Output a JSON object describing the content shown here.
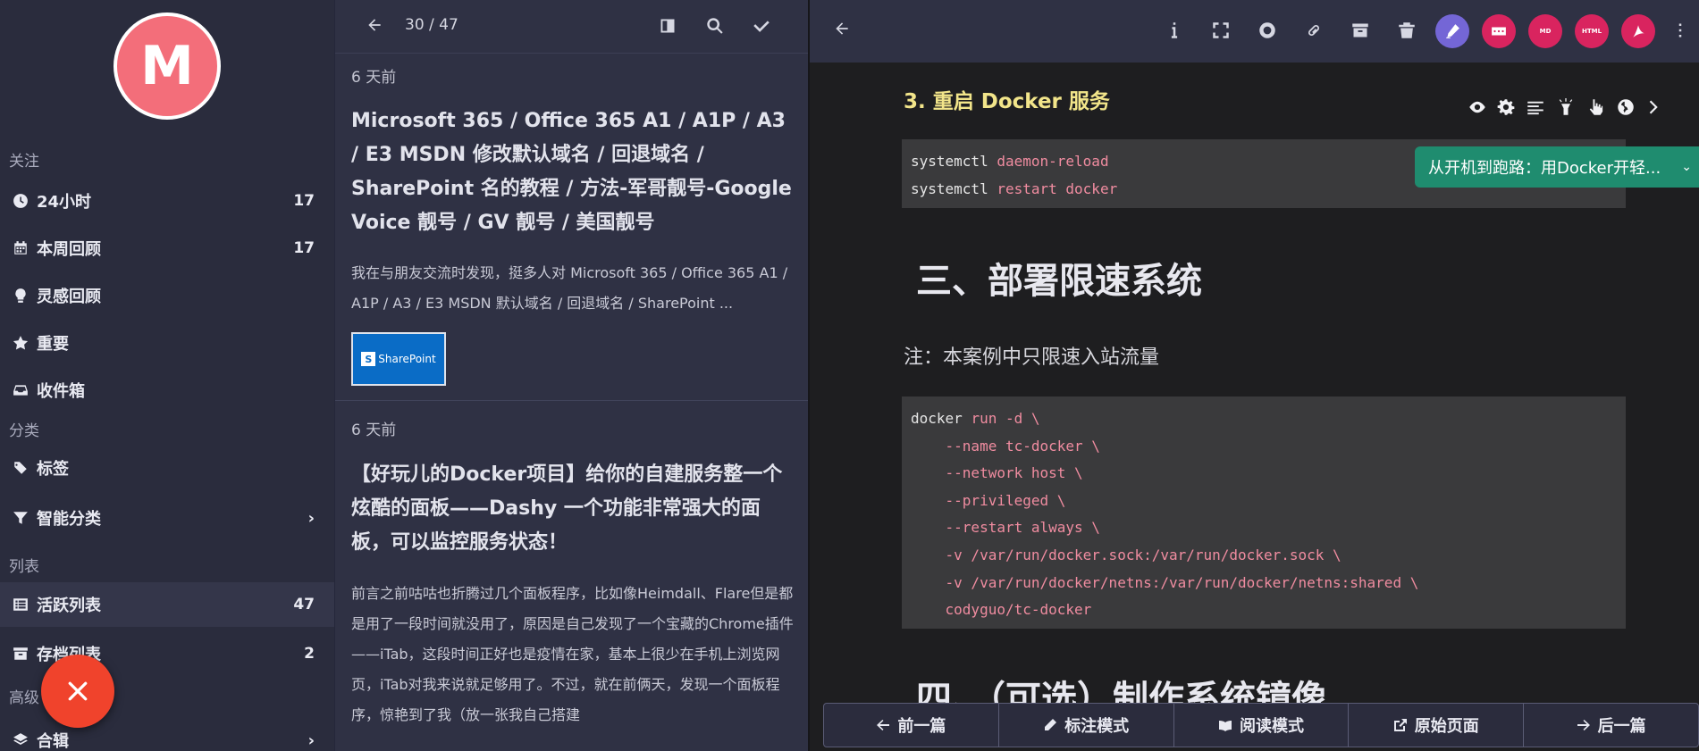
{
  "sidebar": {
    "avatar_letter": "M",
    "sections": {
      "follow": "关注",
      "category": "分类",
      "lists": "列表",
      "advanced": "高级"
    },
    "items": [
      {
        "label": "24小时",
        "count": "17",
        "icon": "clock-icon"
      },
      {
        "label": "本周回顾",
        "count": "17",
        "icon": "calendar-icon"
      },
      {
        "label": "灵感回顾",
        "count": "",
        "icon": "lightbulb-icon"
      },
      {
        "label": "重要",
        "count": "",
        "icon": "star-icon"
      },
      {
        "label": "收件箱",
        "count": "",
        "icon": "inbox-icon"
      },
      {
        "label": "标签",
        "count": "",
        "icon": "tags-icon"
      },
      {
        "label": "智能分类",
        "count": "",
        "icon": "filter-icon"
      },
      {
        "label": "活跃列表",
        "count": "47",
        "icon": "list-icon"
      },
      {
        "label": "存档列表",
        "count": "2",
        "icon": "archive-icon"
      },
      {
        "label": "合辑",
        "count": "",
        "icon": "layers-icon"
      }
    ],
    "fab_icon": "close-icon"
  },
  "list": {
    "counter": "30 / 47",
    "articles": [
      {
        "date": "6 天前",
        "title": "Microsoft 365 / Office 365 A1 / A1P / A3 / E3 MSDN 修改默认域名 / 回退域名 / SharePoint 名的教程 / 方法-军哥靓号-Google Voice 靓号 / GV 靓号 / 美国靓号",
        "excerpt": "我在与朋友交流时发现，挺多人对 Microsoft 365 / Office 365 A1 / A1P / A3 / E3 MSDN 默认域名 / 回退域名 / SharePoint ...",
        "thumb_text": "SharePoint",
        "thumb_mark": "S"
      },
      {
        "date": "6 天前",
        "title": "【好玩儿的Docker项目】给你的自建服务整一个炫酷的面板——Dashy 一个功能非常强大的面板，可以监控服务状态！",
        "excerpt": "前言之前咕咕也折腾过几个面板程序，比如像Heimdall、Flare但是都是用了一段时间就没用了，原因是自己发现了一个宝藏的Chrome插件——iTab，这段时间正好也是疫情在家，基本上很少在手机上浏览网页，iTab对我来说就足够用了。不过，就在前俩天，发现一个面板程序，惊艳到了我（放一张我自己搭建"
      }
    ]
  },
  "reader": {
    "h3": "3. 重启 Docker 服务",
    "code1": [
      {
        "cmd": "systemctl",
        "arg": "daemon-reload"
      },
      {
        "cmd": "systemctl",
        "arg": "restart docker"
      }
    ],
    "h2a": "三、部署限速系统",
    "note": "注：本案例中只限速入站流量",
    "code2_first_cmd": "docker",
    "code2_first_arg": "run -d \\",
    "code2": [
      "    --name tc-docker \\",
      "    --network host \\",
      "    --privileged \\",
      "    --restart always \\",
      "    -v /var/run/docker.sock:/var/run/docker.sock \\",
      "    -v /var/run/docker/netns:/var/run/docker/netns:shared \\",
      "    codyguo/tc-docker"
    ],
    "h2b": "四、（可选）制作系统镜像",
    "toc": "从开机到跑路：用Docker开轻...",
    "toolbar_circles": {
      "md": "MD",
      "html": "HTML"
    },
    "bottom": {
      "prev": "前一篇",
      "annotate": "标注模式",
      "read": "阅读模式",
      "original": "原始页面",
      "next": "后一篇"
    }
  }
}
